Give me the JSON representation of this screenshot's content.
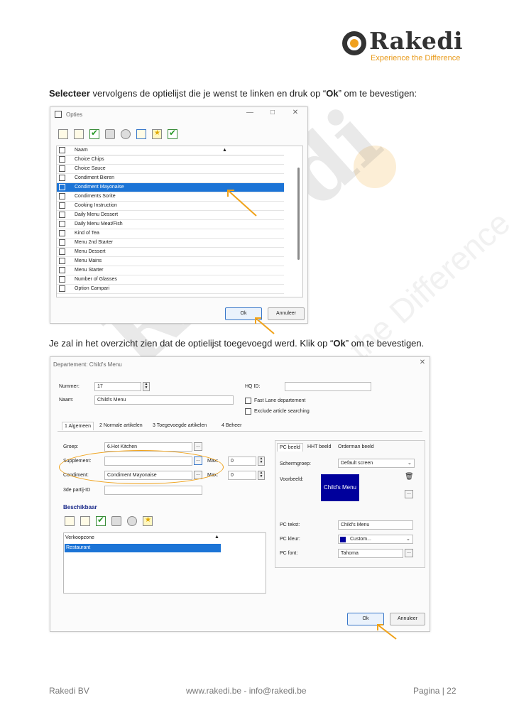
{
  "logo": {
    "name": "Rakedi",
    "tagline": "Experience the Difference"
  },
  "watermark": {
    "word": "Rakedi",
    "tagline": "Experience the Difference"
  },
  "paragraph1": {
    "bold1": "Selecteer",
    "text1": " vervolgens de optielijst die je wenst te linken en druk op “",
    "bold2": "Ok",
    "text2": "” om te bevestigen:"
  },
  "paragraph2": {
    "text1": "Je zal in het overzicht zien dat de optielijst toegevoegd werd. Klik op “",
    "bold1": "Ok",
    "text2": "” om te bevestigen."
  },
  "opties": {
    "title": "Opties",
    "column_header": "Naam",
    "items": [
      "Choice Chips",
      "Choice Sauce",
      "Condiment Bieren",
      "Condiment Mayonaise",
      "Condiments Sorite",
      "Cooking Instruction",
      "Daily Menu Dessert",
      "Daily Menu Meat/Fish",
      "Kind of Tea",
      "Menu 2nd Starter",
      "Menu Dessert",
      "Menu Mains",
      "Menu Starter",
      "Number of Glasses",
      "Option Campari"
    ],
    "selected_index": 3,
    "ok": "Ok",
    "cancel": "Annuleer"
  },
  "departement": {
    "title": "Departement: Child's Menu",
    "nummer_label": "Nummer:",
    "nummer_value": "17",
    "naam_label": "Naam:",
    "naam_value": "Child's Menu",
    "hq_label": "HQ ID:",
    "fastlane": "Fast Lane departement",
    "exclude": "Exclude article searching",
    "tabs": [
      "1 Algemeen",
      "2 Normale artikelen",
      "3 Toegevoegde artikelen",
      "4 Beheer"
    ],
    "groep_label": "Groep:",
    "groep_value": "6.Hot Kitchen",
    "supplement_label": "Supplement:",
    "condiment_label": "Condiment:",
    "condiment_value": "Condiment Mayonaise",
    "max_label": "Max:",
    "max1_value": "0",
    "max2_value": "0",
    "derde_label": "3de partij-ID",
    "beschikbaar": "Beschikbaar",
    "verkoop_header": "Verkoopzone",
    "verkoop_items": [
      "Restaurant"
    ],
    "right_tabs": [
      "PC beeld",
      "HHT beeld",
      "Orderman beeld"
    ],
    "schermgroep_label": "Schermgroep:",
    "schermgroep_value": "Default screen",
    "voorbeeld_label": "Voorbeeld:",
    "voorbeeld_text": "Child's Menu",
    "pctekst_label": "PC tekst:",
    "pctekst_value": "Child's Menu",
    "pckleur_label": "PC kleur:",
    "pckleur_value": "Custom...",
    "pcfont_label": "PC font:",
    "pcfont_value": "Tahoma",
    "ok": "Ok",
    "cancel": "Annuleer"
  },
  "colors": {
    "accent": "#f0a21a",
    "selection": "#1c74d6",
    "preview": "#00009c"
  },
  "footer": {
    "left": "Rakedi BV",
    "center": "www.rakedi.be - info@rakedi.be",
    "right": "Pagina | 22"
  }
}
